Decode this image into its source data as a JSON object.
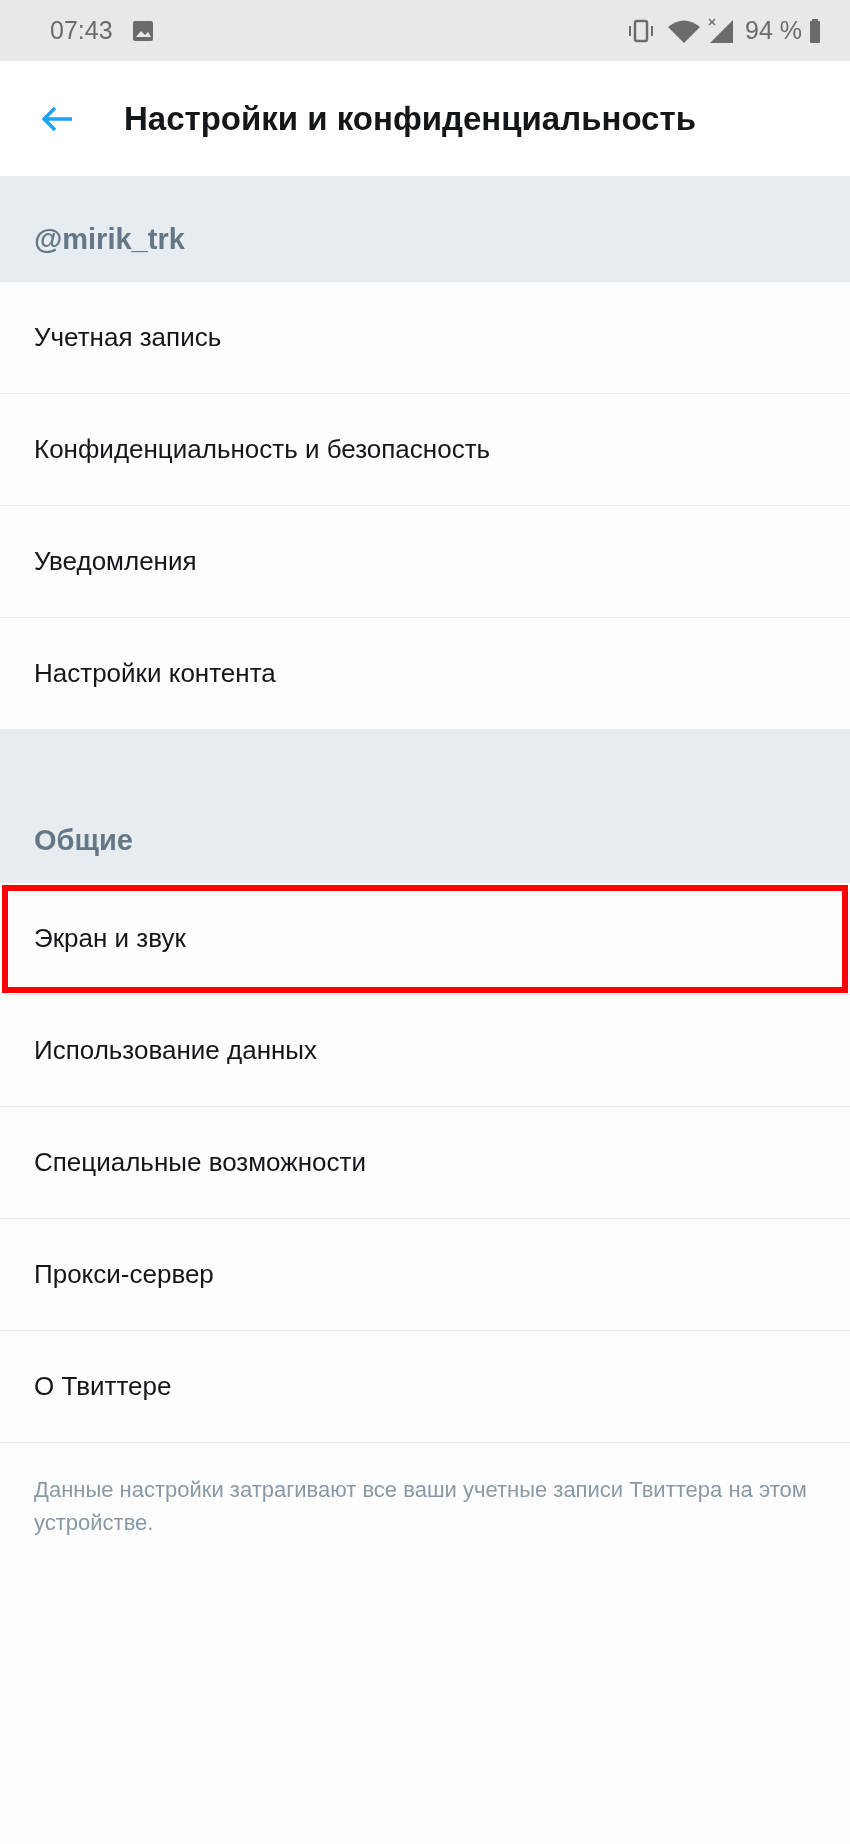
{
  "status_bar": {
    "time": "07:43",
    "battery": "94 %"
  },
  "header": {
    "title": "Настройки и конфиденциальность"
  },
  "sections": [
    {
      "title": "@mirik_trk",
      "items": [
        {
          "label": "Учетная запись",
          "highlighted": false
        },
        {
          "label": "Конфиденциальность и безопасность",
          "highlighted": false
        },
        {
          "label": "Уведомления",
          "highlighted": false
        },
        {
          "label": "Настройки контента",
          "highlighted": false
        }
      ]
    },
    {
      "title": "Общие",
      "items": [
        {
          "label": "Экран и звук",
          "highlighted": true
        },
        {
          "label": "Использование данных",
          "highlighted": false
        },
        {
          "label": "Специальные возможности",
          "highlighted": false
        },
        {
          "label": "Прокси-сервер",
          "highlighted": false
        },
        {
          "label": "О Твиттере",
          "highlighted": false
        }
      ]
    }
  ],
  "footer": "Данные настройки затрагивают все ваши учетные записи Твиттера на этом устройстве."
}
